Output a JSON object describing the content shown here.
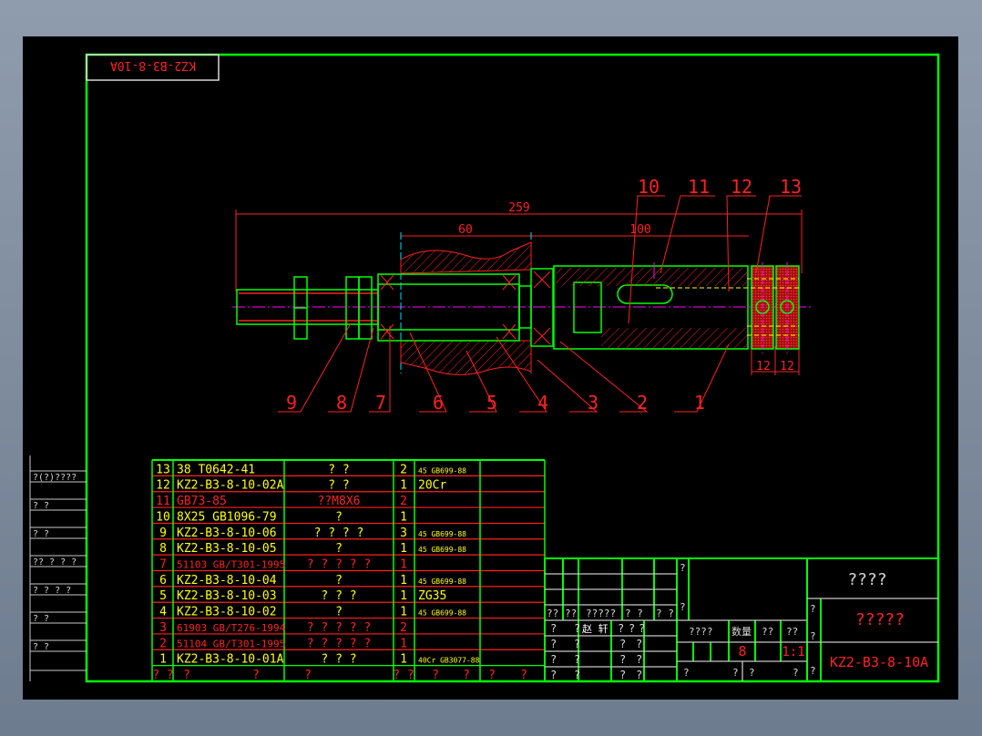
{
  "drawing": {
    "corner_code": "KZ2-B3-8-10A",
    "dimensions": {
      "overall": "259",
      "housing": "60",
      "body": "100",
      "disk_a": "12",
      "disk_b": "12"
    },
    "balloons_bottom": [
      "9",
      "8",
      "7",
      "6",
      "5",
      "4",
      "3",
      "2",
      "1"
    ],
    "balloons_top": [
      "10",
      "11",
      "12",
      "13"
    ]
  },
  "bom": {
    "rows": [
      {
        "no": "13",
        "code": "38 T0642-41",
        "name": "? ?",
        "qty": "2",
        "material": "45 GB699-88",
        "color": "yellow"
      },
      {
        "no": "12",
        "code": "KZ2-B3-8-10-02A",
        "name": "? ?",
        "qty": "1",
        "material": "20Cr",
        "color": "yellow"
      },
      {
        "no": "11",
        "code": "GB73-85",
        "name": "??M8X6",
        "qty": "2",
        "material": "",
        "color": "red"
      },
      {
        "no": "10",
        "code": "8X25 GB1096-79",
        "name": "?",
        "qty": "1",
        "material": "",
        "color": "yellow"
      },
      {
        "no": "9",
        "code": "KZ2-B3-8-10-06",
        "name": "? ? ? ?",
        "qty": "3",
        "material": "45 GB699-88",
        "color": "yellow"
      },
      {
        "no": "8",
        "code": "KZ2-B3-8-10-05",
        "name": "?",
        "qty": "1",
        "material": "45 GB699-88",
        "color": "yellow"
      },
      {
        "no": "7",
        "code": "51103 GB/T301-1995",
        "name": "? ? ? ? ?",
        "qty": "1",
        "material": "",
        "color": "red"
      },
      {
        "no": "6",
        "code": "KZ2-B3-8-10-04",
        "name": "?",
        "qty": "1",
        "material": "45 GB699-88",
        "color": "yellow"
      },
      {
        "no": "5",
        "code": "KZ2-B3-8-10-03",
        "name": "? ? ?",
        "qty": "1",
        "material": "ZG35",
        "color": "yellow"
      },
      {
        "no": "4",
        "code": "KZ2-B3-8-10-02",
        "name": "?",
        "qty": "1",
        "material": "45 GB699-88",
        "color": "yellow"
      },
      {
        "no": "3",
        "code": "61903 GB/T276-1994",
        "name": "? ? ? ? ?",
        "qty": "2",
        "material": "",
        "color": "red"
      },
      {
        "no": "2",
        "code": "51104 GB/T301-1995",
        "name": "? ? ? ? ?",
        "qty": "1",
        "material": "",
        "color": "red"
      },
      {
        "no": "1",
        "code": "KZ2-B3-8-10-01A",
        "name": "? ? ?",
        "qty": "1",
        "material": "40Cr GB3077-88",
        "color": "yellow"
      }
    ],
    "header": {
      "no": "? ?",
      "code": "?",
      "name_a": "?",
      "name_b": "?",
      "qty": "? ?",
      "mat_a": "?",
      "mat_b": "?",
      "note_a": "?",
      "note_b": "?"
    }
  },
  "title_block": {
    "title_top": "????",
    "part_name": "?????",
    "drawing_no": "KZ2-B3-8-10A",
    "weight_label": "????",
    "quantity_label": "数量",
    "col_a": "??",
    "col_b": "??",
    "quantity": "8",
    "scale": "1:1",
    "designer": "赵 轩",
    "sign_row": [
      "??",
      "??",
      "?????",
      "?  ?",
      "?  ?"
    ],
    "q": "?"
  },
  "left_strip": [
    "?(?)????",
    "?    ?",
    "?    ?",
    "?? ? ? ?",
    "? ? ? ?",
    "?    ?",
    "?    ?"
  ]
}
